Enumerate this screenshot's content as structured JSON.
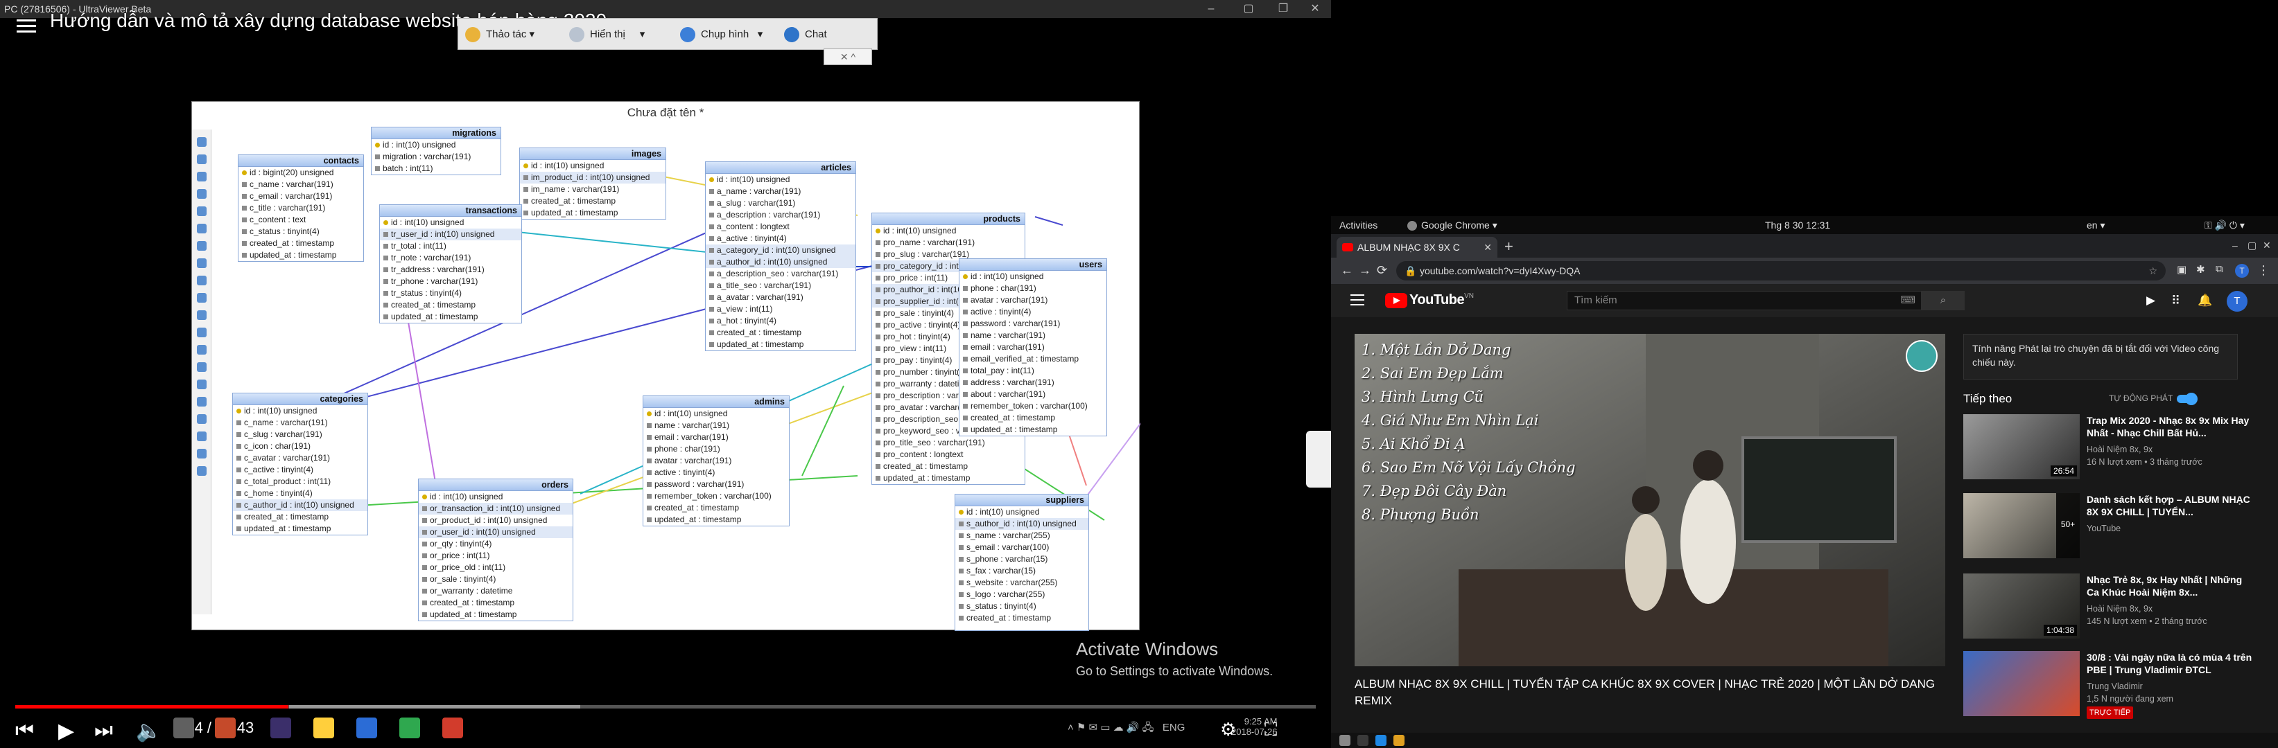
{
  "remote_window": {
    "title": "PC (27816506) - UltraViewer Beta",
    "toolbar": {
      "items": [
        {
          "label": "Thảo tác",
          "icon": "hand-icon"
        },
        {
          "label": "Hiển thị",
          "icon": "monitor-icon"
        },
        {
          "label": "Chụp hình",
          "icon": "camera-icon"
        },
        {
          "label": "Chat",
          "icon": "chat-icon"
        }
      ],
      "mini_controls": "✕ ^"
    }
  },
  "video_overlay": {
    "title": "Hướng dẫn và mô tả xây dựng database website bán hàng 2020"
  },
  "erd": {
    "title": "Chưa đặt tên *",
    "tables": [
      {
        "name": "migrations",
        "header": "migrations",
        "rows": [
          "id : int(10) unsigned",
          "migration : varchar(191)",
          "batch : int(11)"
        ]
      },
      {
        "name": "images",
        "header": "images",
        "rows": [
          "id : int(10) unsigned",
          "im_product_id : int(10) unsigned",
          "im_name : varchar(191)",
          "created_at : timestamp",
          "updated_at : timestamp"
        ]
      },
      {
        "name": "articles",
        "header": "articles",
        "rows": [
          "id : int(10) unsigned",
          "a_name : varchar(191)",
          "a_slug : varchar(191)",
          "a_description : varchar(191)",
          "a_content : longtext",
          "a_active : tinyint(4)",
          "a_category_id : int(10) unsigned",
          "a_author_id : int(10) unsigned",
          "a_description_seo : varchar(191)",
          "a_title_seo : varchar(191)",
          "a_avatar : varchar(191)",
          "a_view : int(11)",
          "a_hot : tinyint(4)",
          "created_at : timestamp",
          "updated_at : timestamp"
        ]
      },
      {
        "name": "contacts",
        "header": "contacts",
        "rows": [
          "id : bigint(20) unsigned",
          "c_name : varchar(191)",
          "c_email : varchar(191)",
          "c_title : varchar(191)",
          "c_content : text",
          "c_status : tinyint(4)",
          "created_at : timestamp",
          "updated_at : timestamp"
        ]
      },
      {
        "name": "transactions",
        "header": "transactions",
        "rows": [
          "id : int(10) unsigned",
          "tr_user_id : int(10) unsigned",
          "tr_total : int(11)",
          "tr_note : varchar(191)",
          "tr_address : varchar(191)",
          "tr_phone : varchar(191)",
          "tr_status : tinyint(4)",
          "created_at : timestamp",
          "updated_at : timestamp"
        ]
      },
      {
        "name": "products",
        "header": "products",
        "rows": [
          "id : int(10) unsigned",
          "pro_name : varchar(191)",
          "pro_slug : varchar(191)",
          "pro_category_id : int(10) unsigned",
          "pro_price : int(11)",
          "pro_author_id : int(10) unsigned",
          "pro_supplier_id : int(10) unsigned",
          "pro_sale : tinyint(4)",
          "pro_active : tinyint(4)",
          "pro_hot : tinyint(4)",
          "pro_view : int(11)",
          "pro_pay : tinyint(4)",
          "pro_number : tinyint(4)",
          "pro_warranty : datetime",
          "pro_description : varchar(191)",
          "pro_avatar : varchar(191)",
          "pro_description_seo : varchar(191)",
          "pro_keyword_seo : varchar(191)",
          "pro_title_seo : varchar(191)",
          "pro_content : longtext",
          "created_at : timestamp",
          "updated_at : timestamp"
        ]
      },
      {
        "name": "users",
        "header": "users",
        "rows": [
          "id : int(10) unsigned",
          "phone : char(191)",
          "avatar : varchar(191)",
          "active : tinyint(4)",
          "password : varchar(191)",
          "name : varchar(191)",
          "email : varchar(191)",
          "email_verified_at : timestamp",
          "total_pay : int(11)",
          "address : varchar(191)",
          "about : varchar(191)",
          "remember_token : varchar(100)",
          "created_at : timestamp",
          "updated_at : timestamp"
        ]
      },
      {
        "name": "categories",
        "header": "categories",
        "rows": [
          "id : int(10) unsigned",
          "c_name : varchar(191)",
          "c_slug : varchar(191)",
          "c_icon : char(191)",
          "c_avatar : varchar(191)",
          "c_active : tinyint(4)",
          "c_total_product : int(11)",
          "c_home : tinyint(4)",
          "c_author_id : int(10) unsigned",
          "created_at : timestamp",
          "updated_at : timestamp"
        ]
      },
      {
        "name": "admins",
        "header": "admins",
        "rows": [
          "id : int(10) unsigned",
          "name : varchar(191)",
          "email : varchar(191)",
          "phone : char(191)",
          "avatar : varchar(191)",
          "active : tinyint(4)",
          "password : varchar(191)",
          "remember_token : varchar(100)",
          "created_at : timestamp",
          "updated_at : timestamp"
        ]
      },
      {
        "name": "orders",
        "header": "orders",
        "rows": [
          "id : int(10) unsigned",
          "or_transaction_id : int(10) unsigned",
          "or_product_id : int(10) unsigned",
          "or_user_id : int(10) unsigned",
          "or_qty : tinyint(4)",
          "or_price : int(11)",
          "or_price_old : int(11)",
          "or_sale : tinyint(4)",
          "or_warranty : datetime",
          "created_at : timestamp",
          "updated_at : timestamp"
        ]
      },
      {
        "name": "suppliers",
        "header": "suppliers",
        "rows": [
          "id : int(10) unsigned",
          "s_author_id : int(10) unsigned",
          "s_name : varchar(255)",
          "s_email : varchar(100)",
          "s_phone : varchar(15)",
          "s_fax : varchar(15)",
          "s_website : varchar(255)",
          "s_logo : varchar(255)",
          "s_status : tinyint(4)",
          "created_at : timestamp"
        ]
      }
    ]
  },
  "activate_windows": {
    "line1": "Activate Windows",
    "line2": "Go to Settings to activate Windows."
  },
  "player": {
    "time": "3:04 / 14:43",
    "progress": 0.21
  },
  "left_tray": {
    "lang": "ENG",
    "time": "9:25 AM",
    "date": "2018-07-26"
  },
  "gnome": {
    "activities": "Activities",
    "app": "Google Chrome ▾",
    "clock": "Thg 8 30  12:31",
    "lang": "en ▾"
  },
  "chrome": {
    "tab_title": "ALBUM NHẠC 8X 9X C",
    "url": "youtube.com/watch?v=dyI4Xwy-DQA"
  },
  "youtube": {
    "logo": "YouTube",
    "region": "VN",
    "search_placeholder": "Tìm kiếm",
    "avatar_letter": "T",
    "video_title": "ALBUM NHẠC 8X 9X CHILL | TUYỂN TẬP CA KHÚC 8X 9X COVER | NHẠC TRẺ 2020 | MỘT LẦN DỞ DANG REMIX",
    "thumbnail_songs": [
      "1. Một Lần Dở Dang",
      "2. Sai Em Đẹp Lắm",
      "3. Hình Lưng Cũ",
      "4. Giá Như Em Nhìn Lại",
      "5. Ai Khổ Đi Ạ",
      "6. Sao Em Nỡ Vội Lấy Chồng",
      "7. Đẹp Đôi Cây Đàn",
      "8. Phượng Buồn"
    ],
    "chat_notice": "Tính năng Phát lại trò chuyện đã bị tắt đối với Video công chiếu này.",
    "up_next": "Tiếp theo",
    "autoplay": "TỰ ĐỘNG PHÁT",
    "recommendations": [
      {
        "title": "Trap Mix 2020 - Nhạc 8x 9x Mix Hay Nhất - Nhạc Chill Bất Hủ...",
        "channel": "Hoài Niệm 8x, 9x",
        "meta": "16 N lượt xem • 3 tháng trước",
        "duration": "26:54"
      },
      {
        "title": "Danh sách kết hợp – ALBUM NHẠC 8X 9X CHILL | TUYỂN...",
        "channel": "YouTube",
        "meta": "",
        "duration": "50+"
      },
      {
        "title": "Nhạc Trẻ 8x, 9x Hay Nhất | Những Ca Khúc Hoài Niệm 8x...",
        "channel": "Hoài Niệm 8x, 9x",
        "meta": "145 N lượt xem • 2 tháng trước",
        "duration": "1:04:38"
      },
      {
        "title": "30/8 : Vài ngày nữa là có mùa 4 trên PBE | Trung Vladimir ĐTCL",
        "channel": "Trung Vladimir",
        "meta": "1,5 N người đang xem",
        "live": "TRỰC TIẾP"
      }
    ]
  }
}
